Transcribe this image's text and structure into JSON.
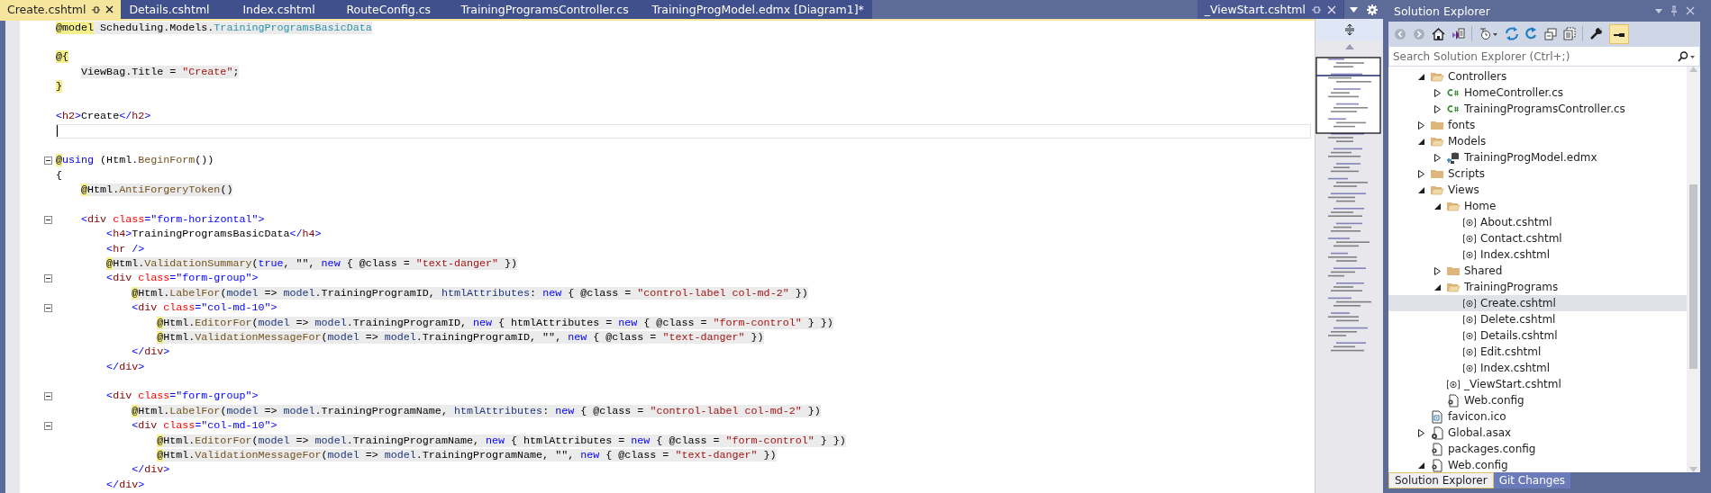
{
  "tabs": [
    {
      "label": "Create.cshtml",
      "selected": true
    },
    {
      "label": "Details.cshtml",
      "selected": false
    },
    {
      "label": "Index.cshtml",
      "selected": false
    },
    {
      "label": "RouteConfig.cs",
      "selected": false
    },
    {
      "label": "TrainingProgramsController.cs",
      "selected": false
    },
    {
      "label": "TrainingProgModel.edmx [Diagram1]*",
      "selected": false
    }
  ],
  "preview_tab": {
    "label": "_ViewStart.cshtml"
  },
  "editor": {
    "lines": [
      {
        "kind": "code",
        "shaded": true,
        "tokens": [
          {
            "text": "@model",
            "kind": "at"
          },
          {
            "text": " Scheduling.Models.",
            "kind": "plain"
          },
          {
            "text": "TrainingProgramsBasicData",
            "kind": "type"
          }
        ]
      },
      {
        "kind": "blank"
      },
      {
        "kind": "code",
        "tokens": [
          {
            "text": "@{",
            "kind": "at"
          }
        ]
      },
      {
        "kind": "code",
        "shaded": true,
        "tokens": [
          {
            "text": "    ViewBag.Title = ",
            "kind": "plain"
          },
          {
            "text": "\"Create\"",
            "kind": "str"
          },
          {
            "text": ";",
            "kind": "plain"
          }
        ]
      },
      {
        "kind": "code",
        "tokens": [
          {
            "text": "}",
            "kind": "at"
          }
        ]
      },
      {
        "kind": "blank"
      },
      {
        "kind": "code",
        "shaded": false,
        "tokens": [
          {
            "text": "<",
            "kind": "punct"
          },
          {
            "text": "h2",
            "kind": "tag"
          },
          {
            "text": ">",
            "kind": "punct"
          },
          {
            "text": "Create",
            "kind": "plain"
          },
          {
            "text": "</",
            "kind": "punct"
          },
          {
            "text": "h2",
            "kind": "tag"
          },
          {
            "text": ">",
            "kind": "punct"
          }
        ]
      },
      {
        "kind": "caret"
      },
      {
        "kind": "blank"
      },
      {
        "kind": "code",
        "shaded": false,
        "fold": true,
        "tokens": [
          {
            "text": "@",
            "kind": "at"
          },
          {
            "text": "using",
            "kind": "kw"
          },
          {
            "text": " (Html.",
            "kind": "plain"
          },
          {
            "text": "BeginForm",
            "kind": "method"
          },
          {
            "text": "())",
            "kind": "plain"
          }
        ]
      },
      {
        "kind": "code",
        "shaded": false,
        "tokens": [
          {
            "text": "{",
            "kind": "plain"
          }
        ]
      },
      {
        "kind": "code",
        "shaded": true,
        "tokens": [
          {
            "text": "    @",
            "kind": "at"
          },
          {
            "text": "Html.",
            "kind": "plain"
          },
          {
            "text": "AntiForgeryToken",
            "kind": "method"
          },
          {
            "text": "()",
            "kind": "plain"
          }
        ]
      },
      {
        "kind": "blank"
      },
      {
        "kind": "code",
        "shaded": false,
        "fold": true,
        "tokens": [
          {
            "text": "    <",
            "kind": "punct"
          },
          {
            "text": "div",
            "kind": "tag"
          },
          {
            "text": " class",
            "kind": "attr"
          },
          {
            "text": "=\"form-horizontal\">",
            "kind": "punct"
          }
        ]
      },
      {
        "kind": "code",
        "shaded": false,
        "tokens": [
          {
            "text": "        <",
            "kind": "punct"
          },
          {
            "text": "h4",
            "kind": "tag"
          },
          {
            "text": ">",
            "kind": "punct"
          },
          {
            "text": "TrainingProgramsBasicData",
            "kind": "plain"
          },
          {
            "text": "</",
            "kind": "punct"
          },
          {
            "text": "h4",
            "kind": "tag"
          },
          {
            "text": ">",
            "kind": "punct"
          }
        ]
      },
      {
        "kind": "code",
        "shaded": false,
        "tokens": [
          {
            "text": "        <",
            "kind": "punct"
          },
          {
            "text": "hr",
            "kind": "tag"
          },
          {
            "text": " />",
            "kind": "punct"
          }
        ]
      },
      {
        "kind": "code",
        "shaded": true,
        "tokens": [
          {
            "text": "        @",
            "kind": "at"
          },
          {
            "text": "Html.",
            "kind": "plain"
          },
          {
            "text": "ValidationSummary",
            "kind": "method"
          },
          {
            "text": "(",
            "kind": "plain"
          },
          {
            "text": "true",
            "kind": "kw"
          },
          {
            "text": ", \"\", ",
            "kind": "plain"
          },
          {
            "text": "new",
            "kind": "kw"
          },
          {
            "text": " { @class = ",
            "kind": "plain"
          },
          {
            "text": "\"text-danger\"",
            "kind": "str"
          },
          {
            "text": " })",
            "kind": "plain"
          }
        ]
      },
      {
        "kind": "code",
        "shaded": false,
        "fold": true,
        "tokens": [
          {
            "text": "        <",
            "kind": "punct"
          },
          {
            "text": "div",
            "kind": "tag"
          },
          {
            "text": " class",
            "kind": "attr"
          },
          {
            "text": "=\"form-group\">",
            "kind": "punct"
          }
        ]
      },
      {
        "kind": "code",
        "shaded": true,
        "tokens": [
          {
            "text": "            @",
            "kind": "at"
          },
          {
            "text": "Html.",
            "kind": "plain"
          },
          {
            "text": "LabelFor",
            "kind": "method"
          },
          {
            "text": "(",
            "kind": "plain"
          },
          {
            "text": "model",
            "kind": "param"
          },
          {
            "text": " => ",
            "kind": "plain"
          },
          {
            "text": "model",
            "kind": "param"
          },
          {
            "text": ".TrainingProgramID, ",
            "kind": "plain"
          },
          {
            "text": "htmlAttributes",
            "kind": "param"
          },
          {
            "text": ": ",
            "kind": "plain"
          },
          {
            "text": "new",
            "kind": "kw"
          },
          {
            "text": " { @class = ",
            "kind": "plain"
          },
          {
            "text": "\"control-label col-md-2\"",
            "kind": "str"
          },
          {
            "text": " })",
            "kind": "plain"
          }
        ]
      },
      {
        "kind": "code",
        "shaded": false,
        "fold": true,
        "tokens": [
          {
            "text": "            <",
            "kind": "punct"
          },
          {
            "text": "div",
            "kind": "tag"
          },
          {
            "text": " class",
            "kind": "attr"
          },
          {
            "text": "=\"col-md-10\">",
            "kind": "punct"
          }
        ]
      },
      {
        "kind": "code",
        "shaded": true,
        "tokens": [
          {
            "text": "                @",
            "kind": "at"
          },
          {
            "text": "Html.",
            "kind": "plain"
          },
          {
            "text": "EditorFor",
            "kind": "method"
          },
          {
            "text": "(",
            "kind": "plain"
          },
          {
            "text": "model",
            "kind": "param"
          },
          {
            "text": " => ",
            "kind": "plain"
          },
          {
            "text": "model",
            "kind": "param"
          },
          {
            "text": ".TrainingProgramID, ",
            "kind": "plain"
          },
          {
            "text": "new",
            "kind": "kw"
          },
          {
            "text": " { htmlAttributes = ",
            "kind": "plain"
          },
          {
            "text": "new",
            "kind": "kw"
          },
          {
            "text": " { @class = ",
            "kind": "plain"
          },
          {
            "text": "\"form-control\"",
            "kind": "str"
          },
          {
            "text": " } })",
            "kind": "plain"
          }
        ]
      },
      {
        "kind": "code",
        "shaded": true,
        "tokens": [
          {
            "text": "                @",
            "kind": "at"
          },
          {
            "text": "Html.",
            "kind": "plain"
          },
          {
            "text": "ValidationMessageFor",
            "kind": "method"
          },
          {
            "text": "(",
            "kind": "plain"
          },
          {
            "text": "model",
            "kind": "param"
          },
          {
            "text": " => ",
            "kind": "plain"
          },
          {
            "text": "model",
            "kind": "param"
          },
          {
            "text": ".TrainingProgramID, \"\", ",
            "kind": "plain"
          },
          {
            "text": "new",
            "kind": "kw"
          },
          {
            "text": " { @class = ",
            "kind": "plain"
          },
          {
            "text": "\"text-danger\"",
            "kind": "str"
          },
          {
            "text": " })",
            "kind": "plain"
          }
        ]
      },
      {
        "kind": "code",
        "shaded": false,
        "tokens": [
          {
            "text": "            </",
            "kind": "punct"
          },
          {
            "text": "div",
            "kind": "tag"
          },
          {
            "text": ">",
            "kind": "punct"
          }
        ]
      },
      {
        "kind": "code",
        "shaded": false,
        "tokens": [
          {
            "text": "        </",
            "kind": "punct"
          },
          {
            "text": "div",
            "kind": "tag"
          },
          {
            "text": ">",
            "kind": "punct"
          }
        ]
      },
      {
        "kind": "blank"
      },
      {
        "kind": "code",
        "shaded": false,
        "fold": true,
        "tokens": [
          {
            "text": "        <",
            "kind": "punct"
          },
          {
            "text": "div",
            "kind": "tag"
          },
          {
            "text": " class",
            "kind": "attr"
          },
          {
            "text": "=\"form-group\">",
            "kind": "punct"
          }
        ]
      },
      {
        "kind": "code",
        "shaded": true,
        "tokens": [
          {
            "text": "            @",
            "kind": "at"
          },
          {
            "text": "Html.",
            "kind": "plain"
          },
          {
            "text": "LabelFor",
            "kind": "method"
          },
          {
            "text": "(",
            "kind": "plain"
          },
          {
            "text": "model",
            "kind": "param"
          },
          {
            "text": " => ",
            "kind": "plain"
          },
          {
            "text": "model",
            "kind": "param"
          },
          {
            "text": ".TrainingProgramName, ",
            "kind": "plain"
          },
          {
            "text": "htmlAttributes",
            "kind": "param"
          },
          {
            "text": ": ",
            "kind": "plain"
          },
          {
            "text": "new",
            "kind": "kw"
          },
          {
            "text": " { @class = ",
            "kind": "plain"
          },
          {
            "text": "\"control-label col-md-2\"",
            "kind": "str"
          },
          {
            "text": " })",
            "kind": "plain"
          }
        ]
      },
      {
        "kind": "code",
        "shaded": false,
        "fold": true,
        "tokens": [
          {
            "text": "            <",
            "kind": "punct"
          },
          {
            "text": "div",
            "kind": "tag"
          },
          {
            "text": " class",
            "kind": "attr"
          },
          {
            "text": "=\"col-md-10\">",
            "kind": "punct"
          }
        ]
      },
      {
        "kind": "code",
        "shaded": true,
        "tokens": [
          {
            "text": "                @",
            "kind": "at"
          },
          {
            "text": "Html.",
            "kind": "plain"
          },
          {
            "text": "EditorFor",
            "kind": "method"
          },
          {
            "text": "(",
            "kind": "plain"
          },
          {
            "text": "model",
            "kind": "param"
          },
          {
            "text": " => ",
            "kind": "plain"
          },
          {
            "text": "model",
            "kind": "param"
          },
          {
            "text": ".TrainingProgramName, ",
            "kind": "plain"
          },
          {
            "text": "new",
            "kind": "kw"
          },
          {
            "text": " { htmlAttributes = ",
            "kind": "plain"
          },
          {
            "text": "new",
            "kind": "kw"
          },
          {
            "text": " { @class = ",
            "kind": "plain"
          },
          {
            "text": "\"form-control\"",
            "kind": "str"
          },
          {
            "text": " } })",
            "kind": "plain"
          }
        ]
      },
      {
        "kind": "code",
        "shaded": true,
        "tokens": [
          {
            "text": "                @",
            "kind": "at"
          },
          {
            "text": "Html.",
            "kind": "plain"
          },
          {
            "text": "ValidationMessageFor",
            "kind": "method"
          },
          {
            "text": "(",
            "kind": "plain"
          },
          {
            "text": "model",
            "kind": "param"
          },
          {
            "text": " => ",
            "kind": "plain"
          },
          {
            "text": "model",
            "kind": "param"
          },
          {
            "text": ".TrainingProgramName, \"\", ",
            "kind": "plain"
          },
          {
            "text": "new",
            "kind": "kw"
          },
          {
            "text": " { @class = ",
            "kind": "plain"
          },
          {
            "text": "\"text-danger\"",
            "kind": "str"
          },
          {
            "text": " })",
            "kind": "plain"
          }
        ]
      },
      {
        "kind": "code",
        "shaded": false,
        "tokens": [
          {
            "text": "            </",
            "kind": "punct"
          },
          {
            "text": "div",
            "kind": "tag"
          },
          {
            "text": ">",
            "kind": "punct"
          }
        ]
      },
      {
        "kind": "code",
        "shaded": false,
        "tokens": [
          {
            "text": "        </",
            "kind": "punct"
          },
          {
            "text": "div",
            "kind": "tag"
          },
          {
            "text": ">",
            "kind": "punct"
          }
        ]
      }
    ]
  },
  "solution_explorer": {
    "title": "Solution Explorer",
    "toolbar": {
      "back_disabled": true,
      "forward_disabled": true,
      "preview_on": true
    },
    "search": {
      "placeholder": "Search Solution Explorer (Ctrl+;)"
    },
    "tree": [
      {
        "label": "Controllers",
        "kind": "folder",
        "expanded": true,
        "selected": false,
        "children": [
          {
            "label": "HomeController.cs",
            "kind": "cs",
            "expanded": false,
            "selected": false
          },
          {
            "label": "TrainingProgramsController.cs",
            "kind": "cs",
            "expanded": false,
            "selected": false
          }
        ]
      },
      {
        "label": "fonts",
        "kind": "folder",
        "expanded": false,
        "selected": false
      },
      {
        "label": "Models",
        "kind": "folder",
        "expanded": true,
        "selected": false,
        "children": [
          {
            "label": "TrainingProgModel.edmx",
            "kind": "edmx",
            "expanded": false,
            "selected": false
          }
        ]
      },
      {
        "label": "Scripts",
        "kind": "folder",
        "expanded": false,
        "selected": false
      },
      {
        "label": "Views",
        "kind": "folder",
        "expanded": true,
        "selected": false,
        "children": [
          {
            "label": "Home",
            "kind": "folder",
            "expanded": true,
            "selected": false,
            "children": [
              {
                "label": "About.cshtml",
                "kind": "cshtml",
                "selected": false
              },
              {
                "label": "Contact.cshtml",
                "kind": "cshtml",
                "selected": false
              },
              {
                "label": "Index.cshtml",
                "kind": "cshtml",
                "selected": false
              }
            ]
          },
          {
            "label": "Shared",
            "kind": "folder",
            "expanded": false,
            "selected": false
          },
          {
            "label": "TrainingPrograms",
            "kind": "folder",
            "expanded": true,
            "selected": false,
            "children": [
              {
                "label": "Create.cshtml",
                "kind": "cshtml",
                "selected": true
              },
              {
                "label": "Delete.cshtml",
                "kind": "cshtml",
                "selected": false
              },
              {
                "label": "Details.cshtml",
                "kind": "cshtml",
                "selected": false
              },
              {
                "label": "Edit.cshtml",
                "kind": "cshtml",
                "selected": false
              },
              {
                "label": "Index.cshtml",
                "kind": "cshtml",
                "selected": false
              }
            ]
          },
          {
            "label": "_ViewStart.cshtml",
            "kind": "cshtml",
            "selected": false
          },
          {
            "label": "Web.config",
            "kind": "config",
            "selected": false
          }
        ]
      },
      {
        "label": "favicon.ico",
        "kind": "ico",
        "selected": false
      },
      {
        "label": "Global.asax",
        "kind": "asax",
        "expanded": false,
        "selected": false
      },
      {
        "label": "packages.config",
        "kind": "config",
        "selected": false
      },
      {
        "label": "Web.config",
        "kind": "config",
        "expanded": true,
        "selected": false
      }
    ],
    "bottom_tabs": [
      {
        "label": "Solution Explorer",
        "selected": true
      },
      {
        "label": "Git Changes",
        "selected": false
      }
    ]
  }
}
